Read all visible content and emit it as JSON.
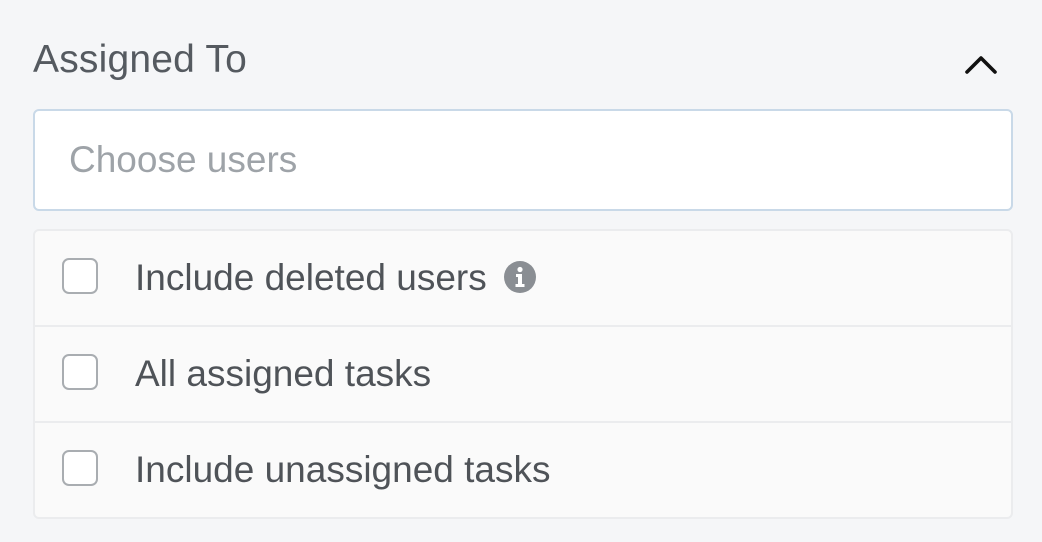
{
  "filter": {
    "title": "Assigned To",
    "collapse_icon": "chevron-up-icon",
    "search": {
      "placeholder": "Choose users",
      "value": ""
    },
    "options": [
      {
        "label": "Include deleted users",
        "checked": false,
        "has_info_icon": true
      },
      {
        "label": "All assigned tasks",
        "checked": false,
        "has_info_icon": false
      },
      {
        "label": "Include unassigned tasks",
        "checked": false,
        "has_info_icon": false
      }
    ]
  },
  "colors": {
    "background": "#f5f6f8",
    "input_border": "#c9d9e8",
    "text": "#555a60",
    "placeholder": "#9ea3a8",
    "info_icon": "#8a8e93"
  }
}
